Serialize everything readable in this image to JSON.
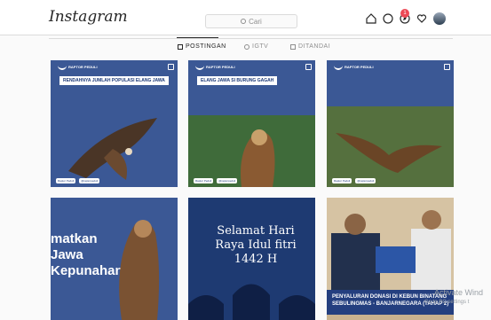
{
  "header": {
    "logo": "Instagram",
    "search_placeholder": "Cari",
    "notification_count": "1"
  },
  "tabs": [
    {
      "label": "POSTINGAN",
      "active": true
    },
    {
      "label": "IGTV",
      "active": false
    },
    {
      "label": "DITANDAI",
      "active": false
    }
  ],
  "brand": "RAPTOR PEDULI",
  "posts": [
    {
      "headline": "RENDAHNYA JUMLAH POPULASI ELANG JAWA",
      "footer": [
        "Raptor Peduli",
        "@raptorpeduli"
      ]
    },
    {
      "headline": "ELANG JAWA SI BURUNG GAGAH",
      "footer": [
        "Raptor Peduli",
        "@raptorpeduli"
      ]
    },
    {
      "headline": "",
      "footer": [
        "Raptor Peduli",
        "@raptorpeduli"
      ]
    },
    {
      "headline_lines": [
        "matkan",
        "Jawa",
        "Kepunahan"
      ]
    },
    {
      "greeting": "Selamat Hari Raya Idul fitri 1442 H"
    },
    {
      "banner": "PENYALURAN DONASI DI KEBUN BINATANG SEBULINGMAS - BANJARNEGARA (TAHAP 2)"
    }
  ],
  "watermark": {
    "title": "Activate Wind",
    "subtitle": "Go to PC settings t"
  },
  "colors": {
    "accent": "#3b5895",
    "badge": "#ed4956",
    "text": "#262626",
    "muted": "#8e8e8e"
  }
}
